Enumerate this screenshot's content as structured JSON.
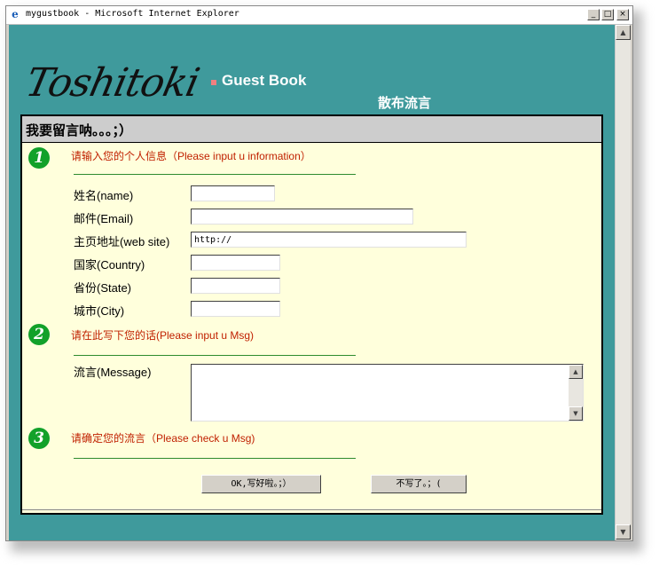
{
  "window": {
    "title": "mygustbook - Microsoft Internet Explorer",
    "minimize_glyph": "_",
    "maximize_glyph": "□",
    "close_glyph": "×"
  },
  "scrollbar": {
    "up_glyph": "▲",
    "down_glyph": "▼"
  },
  "page": {
    "logo_text": "Toshitoki",
    "title": "Guest Book",
    "subtitle": "散布流言",
    "panel_header": "我要留言呐。。。；）"
  },
  "sections": [
    {
      "number": "1",
      "label": "请输入您的个人信息（Please input u information）"
    },
    {
      "number": "2",
      "label": "请在此写下您的话(Please input u Msg)"
    },
    {
      "number": "3",
      "label": "请确定您的流言（Please check u Msg)"
    }
  ],
  "fields": {
    "name": {
      "label": "姓名(name)",
      "value": ""
    },
    "email": {
      "label": "邮件(Email)",
      "value": ""
    },
    "website": {
      "label": "主页地址(web site)",
      "value": "http://"
    },
    "country": {
      "label": "国家(Country)",
      "value": ""
    },
    "state": {
      "label": "省份(State)",
      "value": ""
    },
    "city": {
      "label": "城市(City)",
      "value": ""
    },
    "message": {
      "label": "流言(Message)",
      "value": ""
    }
  },
  "buttons": {
    "submit": "OK,写好啦。；）",
    "cancel": "不写了。；("
  },
  "colors": {
    "page_background": "#3f9a9c",
    "panel_background": "#ffffdc",
    "step_badge": "#12a12a",
    "section_text": "#c02000"
  }
}
